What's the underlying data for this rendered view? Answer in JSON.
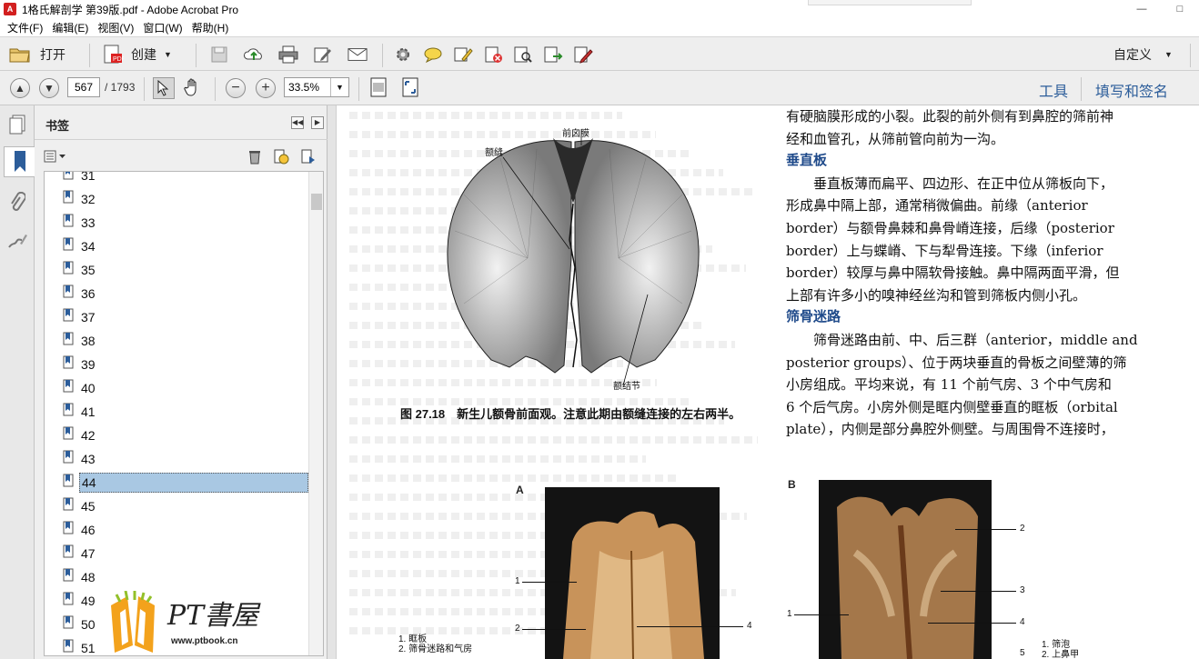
{
  "window": {
    "title": "1格氏解剖学 第39版.pdf - Adobe Acrobat Pro",
    "controls": [
      "—",
      "□"
    ]
  },
  "menu": [
    "文件(F)",
    "编辑(E)",
    "视图(V)",
    "窗口(W)",
    "帮助(H)"
  ],
  "toolbar": {
    "open_label": "打开",
    "create_label": "创建",
    "customize_label": "自定义"
  },
  "nav": {
    "page_current": "567",
    "page_total": "/ 1793",
    "zoom": "33.5%",
    "tools_label": "工具",
    "sign_label": "填写和签名"
  },
  "bookmarks": {
    "title": "书签",
    "items": [
      "31",
      "32",
      "33",
      "34",
      "35",
      "36",
      "37",
      "38",
      "39",
      "40",
      "41",
      "42",
      "43",
      "44",
      "45",
      "46",
      "47",
      "48",
      "49",
      "50",
      "51"
    ],
    "selected": "44"
  },
  "document": {
    "figure_labels": {
      "frontal_suture": "额缝",
      "anterior_fontanelle": "前囟膜",
      "frontal_tuber": "额结节"
    },
    "figure_caption": "图 27.18　新生儿额骨前面观。注意此期由额缝连接的左右两半。",
    "body_lines": [
      "有硬脑膜形成的小裂。此裂的前外侧有到鼻腔的筛前神",
      "经和血管孔，从筛前管向前为一沟。"
    ],
    "heading_1": "垂直板",
    "para_1": [
      "　　垂直板薄而扁平、四边形、在正中位从筛板向下，",
      "形成鼻中隔上部，通常稍微偏曲。前缘（anterior",
      "border）与额骨鼻棘和鼻骨嵴连接，后缘（posterior",
      "border）上与蝶嵴、下与犁骨连接。下缘（inferior",
      "border）较厚与鼻中隔软骨接触。鼻中隔两面平滑，但",
      "上部有许多小的嗅神经丝沟和管到筛板内侧小孔。"
    ],
    "heading_2": "筛骨迷路",
    "para_2": [
      "　　筛骨迷路由前、中、后三群（anterior，middle and",
      "posterior groups）、位于两块垂直的骨板之间壁薄的筛",
      "小房组成。平均来说，有 11 个前气房、3 个中气房和",
      "6 个后气房。小房外侧是眶内侧壁垂直的眶板（orbital",
      "plate），内侧是部分鼻腔外侧壁。与周围骨不连接时，"
    ],
    "photo_a": {
      "tag": "A",
      "numbers": [
        "1",
        "2",
        "4"
      ],
      "legend": [
        "1. 眶板",
        "2. 筛骨迷路和气房"
      ]
    },
    "photo_b": {
      "tag": "B",
      "numbers": [
        "2",
        "3",
        "1",
        "4",
        "5"
      ],
      "legend": [
        "1. 筛泡",
        "2. 上鼻甲"
      ]
    },
    "watermark": {
      "title": "PT書屋",
      "url": "www.ptbook.cn"
    }
  },
  "colors": {
    "accent_link": "#2c5d9a",
    "heading": "#1f4a8a",
    "selection": "#a9c8e3"
  }
}
